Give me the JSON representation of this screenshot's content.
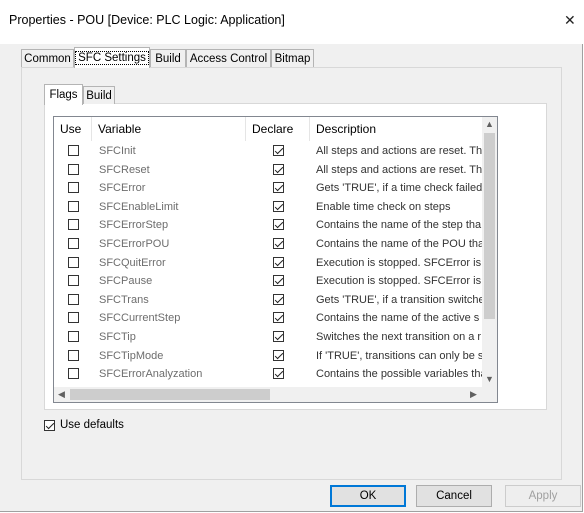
{
  "window": {
    "title": "Properties - POU [Device: PLC Logic: Application]",
    "close_glyph": "✕"
  },
  "tabs": [
    "Common",
    "SFC Settings",
    "Build",
    "Access Control",
    "Bitmap"
  ],
  "inner_tabs": [
    "Flags",
    "Build"
  ],
  "table": {
    "headers": {
      "use": "Use",
      "variable": "Variable",
      "declare": "Declare",
      "description": "Description"
    },
    "rows": [
      {
        "use": false,
        "variable": "SFCInit",
        "declare": true,
        "description": "All steps and actions are reset. Th"
      },
      {
        "use": false,
        "variable": "SFCReset",
        "declare": true,
        "description": "All steps and actions are reset. Th"
      },
      {
        "use": false,
        "variable": "SFCError",
        "declare": true,
        "description": "Gets 'TRUE', if a time check failed."
      },
      {
        "use": false,
        "variable": "SFCEnableLimit",
        "declare": true,
        "description": "Enable time check on steps"
      },
      {
        "use": false,
        "variable": "SFCErrorStep",
        "declare": true,
        "description": "Contains the name of the step tha"
      },
      {
        "use": false,
        "variable": "SFCErrorPOU",
        "declare": true,
        "description": "Contains the name of the POU tha"
      },
      {
        "use": false,
        "variable": "SFCQuitError",
        "declare": true,
        "description": "Execution is stopped. SFCError is r"
      },
      {
        "use": false,
        "variable": "SFCPause",
        "declare": true,
        "description": "Execution is stopped. SFCError is r"
      },
      {
        "use": false,
        "variable": "SFCTrans",
        "declare": true,
        "description": "Gets 'TRUE', if a transition switche"
      },
      {
        "use": false,
        "variable": "SFCCurrentStep",
        "declare": true,
        "description": "Contains the name of the active s"
      },
      {
        "use": false,
        "variable": "SFCTip",
        "declare": true,
        "description": "Switches the next transition on a r"
      },
      {
        "use": false,
        "variable": "SFCTipMode",
        "declare": true,
        "description": "If 'TRUE', transitions can only be s"
      },
      {
        "use": false,
        "variable": "SFCErrorAnalyzation",
        "declare": true,
        "description": "Contains the possible variables tha"
      }
    ]
  },
  "use_defaults": {
    "label": "Use defaults",
    "checked": true
  },
  "buttons": {
    "ok": "OK",
    "cancel": "Cancel",
    "apply": "Apply"
  }
}
